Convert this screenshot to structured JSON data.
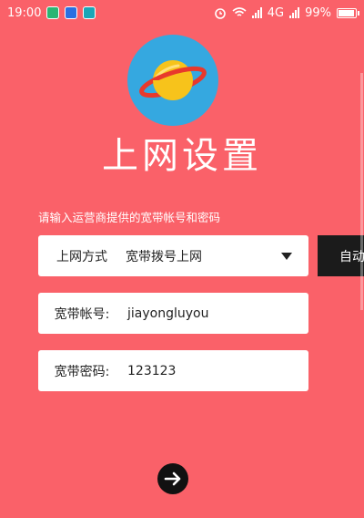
{
  "status_bar": {
    "time": "19:00",
    "network": "4G",
    "battery": "99%"
  },
  "header": {
    "title": "上网设置"
  },
  "form": {
    "hint": "请输入运营商提供的宽带帐号和密码",
    "mode_label": "上网方式",
    "mode_value": "宽带拨号上网",
    "side_button": "自动",
    "account_label": "宽带帐号:",
    "account_value": "jiayongluyou",
    "password_label": "宽带密码:",
    "password_value": "123123"
  },
  "colors": {
    "background": "#fa6169",
    "logo_circle": "#35a8e0",
    "planet": "#f7c31b",
    "ring": "#e8392c",
    "side_button": "#1b1b1b"
  },
  "icons": [
    "wechat-icon",
    "shield-icon",
    "app-icon",
    "alarm-icon",
    "wifi-icon",
    "signal-icon",
    "battery-icon",
    "planet-logo-icon",
    "arrow-right-icon",
    "dropdown-caret-icon"
  ]
}
